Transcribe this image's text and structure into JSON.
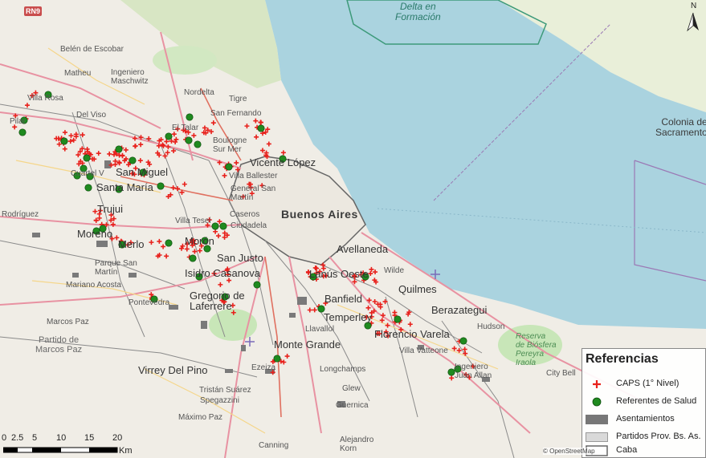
{
  "map": {
    "north_label": "N",
    "route_badge": "RN9",
    "labels": {
      "delta": "Delta en\nFormación",
      "colonia": "Colonia de\nSacramento",
      "belen": "Belén de Escobar",
      "matheu": "Matheu",
      "ingeniero_maschwitz": "Ingeniero\nMaschwitz",
      "villa_rosa": "Villa Rosa",
      "nordelta": "Nordelta",
      "del_viso": "Del Viso",
      "pilar": "Pilar",
      "tigre": "Tigre",
      "san_fernando": "San Fernando",
      "el_talar": "El Talar",
      "boulogne": "Boulogne\nSur Mer",
      "vicente_lopez": "Vicente López",
      "villa_ballester": "Villa Ballester",
      "general_san_martin": "General San\nMartín",
      "san_miguel": "San Miguel",
      "santa_maria": "Santa María",
      "cuartel": "Cuartel V",
      "trujui": "Trujui",
      "rodriguez": "Rodríguez",
      "moreno": "Moreno",
      "merlo": "Merlo",
      "parque_san_martin": "Parque San\nMartín",
      "mariano_acosta": "Mariano Acosta",
      "pontevedra": "Pontevedra",
      "marcos_paz_town": "Marcos Paz",
      "partido_marcos_paz": "Partido de\nMarcos Paz",
      "villa_tesei": "Villa Tesei",
      "caseros": "Caseros",
      "ciudadela": "Ciudadela",
      "moron": "Morón",
      "san_justo": "San Justo",
      "isidro_casanova": "Isidro Casanova",
      "gregorio_laferrere": "Gregorio de\nLaferrere",
      "buenos_aires": "Buenos Aires",
      "avellaneda": "Avellaneda",
      "lanus": "Lanús Oeste",
      "wilde": "Wilde",
      "quilmes": "Quilmes",
      "berazategui": "Berazategui",
      "hudson": "Hudson",
      "banfield": "Banfield",
      "temperley": "Temperley",
      "llavallol": "Llavallol",
      "monte_grande": "Monte Grande",
      "florencio_varela": "Florencio Varela",
      "villa_vatteone": "Villa Vatteone",
      "reserva": "Reserva\nde Biósfera\nPereyra\nIraola",
      "ingeniero_juan_allan": "Ingeniero\nJuan Allan",
      "city_bell": "City Bell",
      "virrey_del_pino": "Virrey Del Pino",
      "tristan_suarez": "Tristán Suárez",
      "spegazzini": "Spegazzini",
      "maximo_paz": "Máximo Paz",
      "ezeiza": "Ezeiza",
      "longchamps": "Longchamps",
      "glew": "Glew",
      "guernica": "Guernica",
      "alejandro_korn": "Alejandro\nKorn",
      "canning": "Canning"
    }
  },
  "legend": {
    "title": "Referencias",
    "items": [
      {
        "label": "CAPS (1° Nivel)",
        "symbol": "red-cross",
        "color": "#e8211c"
      },
      {
        "label": "Referentes de Salud",
        "symbol": "green-dot",
        "color": "#1f8a1f"
      },
      {
        "label": "Asentamientos",
        "symbol": "dark-fill",
        "color": "#777777"
      },
      {
        "label": "Partidos Prov. Bs. As.",
        "symbol": "light-fill",
        "color": "#d9d9d9"
      },
      {
        "label": "Caba",
        "symbol": "outline",
        "color": "#ffffff"
      }
    ]
  },
  "scale": {
    "ticks": [
      "0",
      "2.5",
      "5",
      "10",
      "15",
      "20"
    ],
    "unit": "Km"
  },
  "attribution": "© OpenStreetMap",
  "colors": {
    "water": "#aad3df",
    "land": "#f0ede6",
    "park": "#c8e6b8",
    "caps": "#e8211c",
    "referente": "#1f8a1f"
  }
}
